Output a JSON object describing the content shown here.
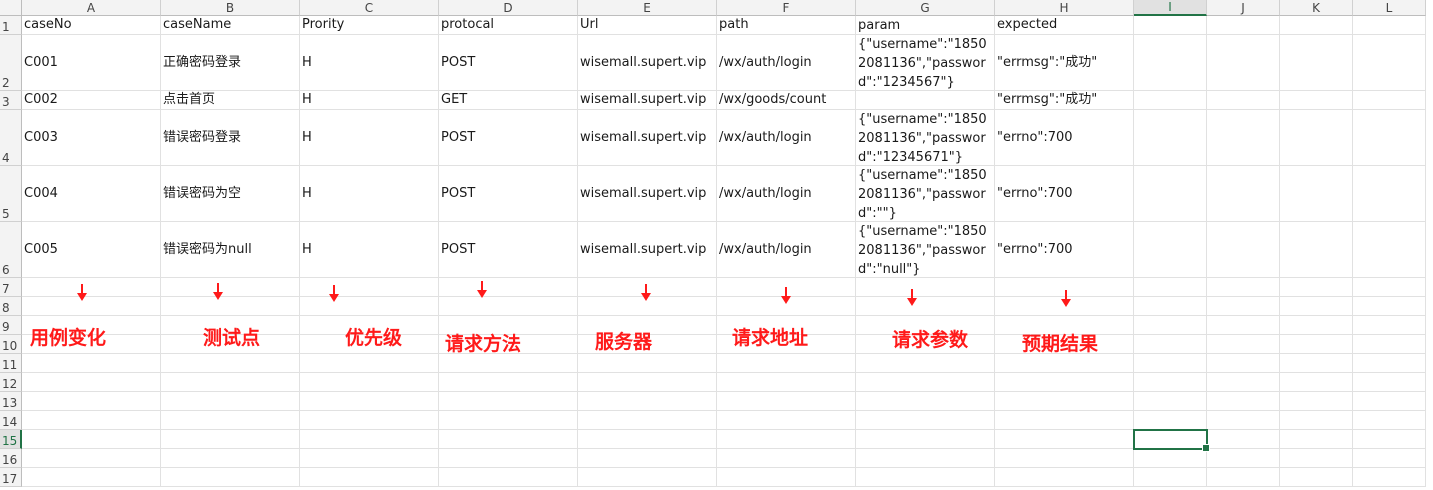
{
  "columns": [
    "A",
    "B",
    "C",
    "D",
    "E",
    "F",
    "G",
    "H",
    "I",
    "J",
    "K",
    "L"
  ],
  "rows": [
    "1",
    "2",
    "3",
    "4",
    "5",
    "6",
    "7",
    "8",
    "9",
    "10",
    "11",
    "12",
    "13",
    "14",
    "15",
    "16",
    "17"
  ],
  "active": {
    "row": "15",
    "column": "I"
  },
  "sheet_rows": [
    [
      "caseNo",
      "caseName",
      "Prority",
      "protocal",
      "Url",
      "path",
      "param",
      "expected"
    ],
    [
      "C001",
      "正确密码登录",
      "H",
      "POST",
      "wisemall.supert.vip",
      "/wx/auth/login",
      "{\"username\":\"18502081136\",\"password\":\"1234567\"}",
      "\"errmsg\":\"成功\""
    ],
    [
      "C002",
      "点击首页",
      "H",
      "GET",
      "wisemall.supert.vip",
      "/wx/goods/count",
      "",
      "\"errmsg\":\"成功\""
    ],
    [
      "C003",
      "错误密码登录",
      "H",
      "POST",
      "wisemall.supert.vip",
      "/wx/auth/login",
      "{\"username\":\"18502081136\",\"password\":\"12345671\"}",
      "\"errno\":700"
    ],
    [
      "C004",
      "错误密码为空",
      "H",
      "POST",
      "wisemall.supert.vip",
      "/wx/auth/login",
      "{\"username\":\"18502081136\",\"password\":\"\"}",
      "\"errno\":700"
    ],
    [
      "C005",
      "错误密码为null",
      "H",
      "POST",
      "wisemall.supert.vip",
      "/wx/auth/login",
      "{\"username\":\"18502081136\",\"password\":\"null\"}",
      "\"errno\":700"
    ]
  ],
  "annotations": [
    "用例变化",
    "测试点",
    "优先级",
    "请求方法",
    "服务器",
    "请求地址",
    "请求参数",
    "预期结果"
  ],
  "colors": {
    "annotation": "#ff1a1a",
    "selection": "#217346",
    "header_bg": "#f3f3f3"
  }
}
